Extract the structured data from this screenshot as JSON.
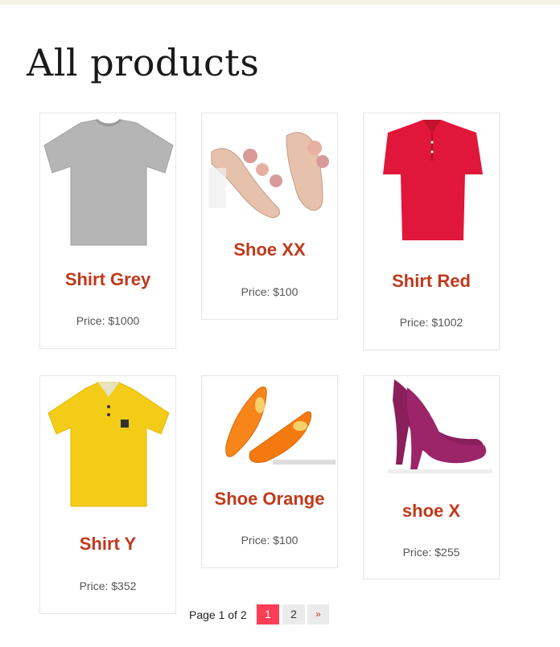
{
  "page": {
    "title": "All products"
  },
  "products": [
    {
      "name": "Shirt Grey",
      "price": "Price: $1000"
    },
    {
      "name": "Shoe XX",
      "price": "Price: $100"
    },
    {
      "name": "Shirt Red",
      "price": "Price: $1002"
    },
    {
      "name": "Shirt Y",
      "price": "Price: $352"
    },
    {
      "name": "Shoe Orange",
      "price": "Price: $100"
    },
    {
      "name": "shoe X",
      "price": "Price: $255"
    }
  ],
  "pagination": {
    "label": "Page 1 of 2",
    "pages": [
      "1",
      "2"
    ],
    "next": "»",
    "current": "1"
  },
  "colors": {
    "accent": "#c0391b",
    "current_page": "#ff3d55",
    "topbar": "#f6f2e5"
  }
}
